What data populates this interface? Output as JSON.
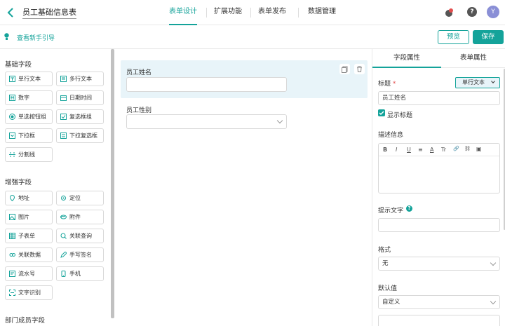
{
  "header": {
    "title": "员工基础信息表",
    "tabs": [
      "表单设计",
      "扩展功能",
      "表单发布",
      "数据管理"
    ],
    "avatar": "Y"
  },
  "subbar": {
    "guide": "查看新手引导",
    "preview": "预览",
    "save": "保存"
  },
  "left": {
    "basic_title": "基础字段",
    "basic": [
      "单行文本",
      "多行文本",
      "数字",
      "日期时间",
      "单选按钮组",
      "复选框组",
      "下拉框",
      "下拉复选框",
      "分割线"
    ],
    "enhanced_title": "增强字段",
    "enhanced": [
      "地址",
      "定位",
      "图片",
      "附件",
      "子表单",
      "关联查询",
      "关联数据",
      "手写签名",
      "流水号",
      "手机",
      "文字识别"
    ],
    "dept_title": "部门成员字段"
  },
  "canvas": {
    "field1_label": "员工姓名",
    "field2_label": "员工性别"
  },
  "right": {
    "tab_field": "字段属性",
    "tab_form": "表单属性",
    "title_label": "标题",
    "required_mark": "*",
    "type_select": "单行文本",
    "title_value": "员工姓名",
    "show_title": "显示标题",
    "desc_label": "描述信息",
    "toolbar": [
      "B",
      "I",
      "U",
      "≡",
      "A",
      "Tr",
      "🔗",
      "⛓",
      "▣"
    ],
    "hint_label": "提示文字",
    "format_label": "格式",
    "format_value": "无",
    "default_label": "默认值",
    "default_value": "自定义"
  },
  "colors": {
    "accent": "#14a39a",
    "field_bg": "#e8f4f9"
  }
}
